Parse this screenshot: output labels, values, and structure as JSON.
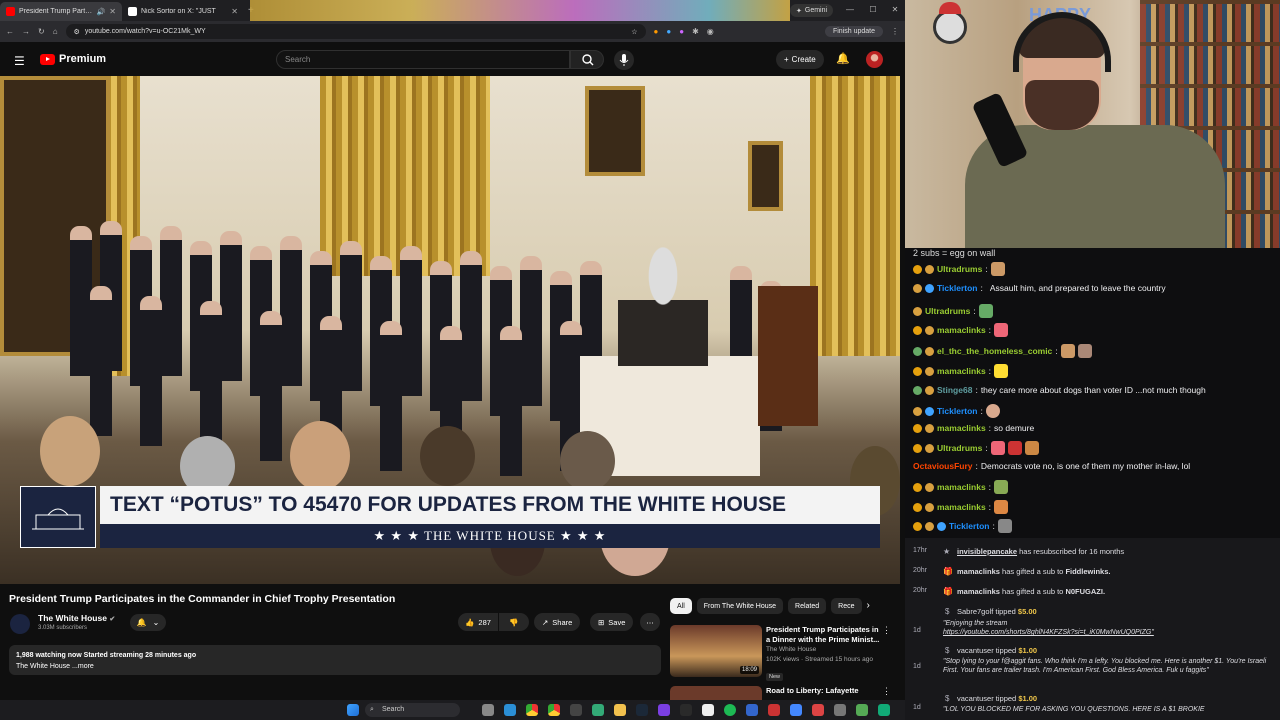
{
  "browser": {
    "tabs": [
      {
        "title": "President Trump Participat",
        "favicon_color": "#ff0000"
      },
      {
        "title": "Nick Sortor on X: \"JUST",
        "favicon_color": "#ffffff"
      }
    ],
    "gemini_label": "Gemini",
    "url": "youtube.com/watch?v=u-OC21Mk_WY",
    "finish_update": "Finish update"
  },
  "youtube": {
    "logo_text": "Premium",
    "search_placeholder": "Search",
    "create_label": "Create",
    "video": {
      "lower_third_text": "TEXT “POTUS” TO 45470 FOR UPDATES FROM THE WHITE HOUSE",
      "lower_third_brand": "★ ★ ★  THE WHITE HOUSE  ★ ★ ★"
    },
    "title": "President Trump Participates in the Commander in Chief Trophy Presentation",
    "channel": {
      "name": "The White House",
      "subscribers": "3.03M subscribers"
    },
    "actions": {
      "likes": "287",
      "share": "Share",
      "save": "Save"
    },
    "description": {
      "stats": "1,988 watching now  Started streaming 28 minutes ago",
      "more": "The White House ...more"
    },
    "chips": [
      "All",
      "From The White House",
      "Related",
      "Rece"
    ],
    "recommendations": [
      {
        "title": "President Trump Participates in a Dinner with the Prime Minist...",
        "channel": "The White House",
        "meta": "102K views · Streamed 15 hours ago",
        "badge": "New",
        "duration": "18:09"
      },
      {
        "title": "Road to Liberty: Lafayette",
        "channel": "",
        "meta": "",
        "badge": "",
        "duration": ""
      }
    ]
  },
  "taskbar": {
    "search_label": "Search"
  },
  "webcam": {
    "sign_text": "HAPPY EAST"
  },
  "chat": {
    "header_partial": "2 subs = egg on wall",
    "messages": [
      {
        "user": "Ultradrums",
        "color": "#9acd32",
        "text": ""
      },
      {
        "user": "Ticklerton",
        "color": "#1e90ff",
        "text": "Assault him, and prepared to leave the country"
      },
      {
        "user": "Ultradrums",
        "color": "#9acd32",
        "text": ""
      },
      {
        "user": "mamaclinks",
        "color": "#9acd32",
        "text": ""
      },
      {
        "user": "el_thc_the_homeless_comic",
        "color": "#9acd32",
        "text": ""
      },
      {
        "user": "mamaclinks",
        "color": "#9acd32",
        "text": ""
      },
      {
        "user": "Stinge68",
        "color": "#5f9ea0",
        "text": "they care more about dogs than voter ID ...not much though"
      },
      {
        "user": "Ticklerton",
        "color": "#1e90ff",
        "text": ""
      },
      {
        "user": "mamaclinks",
        "color": "#9acd32",
        "text": "so demure"
      },
      {
        "user": "Ultradrums",
        "color": "#9acd32",
        "text": ""
      },
      {
        "user": "OctaviousFury",
        "color": "#ff4500",
        "text": "Democrats vote no, is one of them my mother in-law, lol"
      },
      {
        "user": "mamaclinks",
        "color": "#9acd32",
        "text": ""
      },
      {
        "user": "mamaclinks",
        "color": "#9acd32",
        "text": ""
      },
      {
        "user": "Ticklerton",
        "color": "#1e90ff",
        "text": ""
      }
    ]
  },
  "events": [
    {
      "time": "17hr",
      "user": "invisiblepancake",
      "text": "has resubscribed for 16 months"
    },
    {
      "time": "20hr",
      "user": "mamaclinks",
      "text": "has gifted a sub to",
      "target": "Fiddlewinks."
    },
    {
      "time": "20hr",
      "user": "mamaclinks",
      "text": "has gifted a sub to",
      "target": "N0FUGAZI."
    },
    {
      "time": "1d",
      "user": "Sabre7golf",
      "text": "tipped",
      "amount": "$5.00",
      "message": "\"Enjoying the stream",
      "link": "https://youtube.com/shorts/8ghlN4KFZSk?si=t_iK0MwNwUQ0PIZG\""
    },
    {
      "time": "1d",
      "user": "vacantuser",
      "text": "tipped",
      "amount": "$1.00",
      "message": "\"Stop lying to your f@aggit fans. Who think I'm a lefty. You blocked me. Here is another $1. You're Israeli First. Your fans are trailer trash. I'm American First. God Bless America. Fuk u faggits\""
    },
    {
      "time": "1d",
      "user": "vacantuser",
      "text": "tipped",
      "amount": "$1.00",
      "message": "\"LOL YOU BLOCKED ME FOR ASKING YOU QUESTIONS. HERE IS A $1 BROKIE"
    }
  ]
}
